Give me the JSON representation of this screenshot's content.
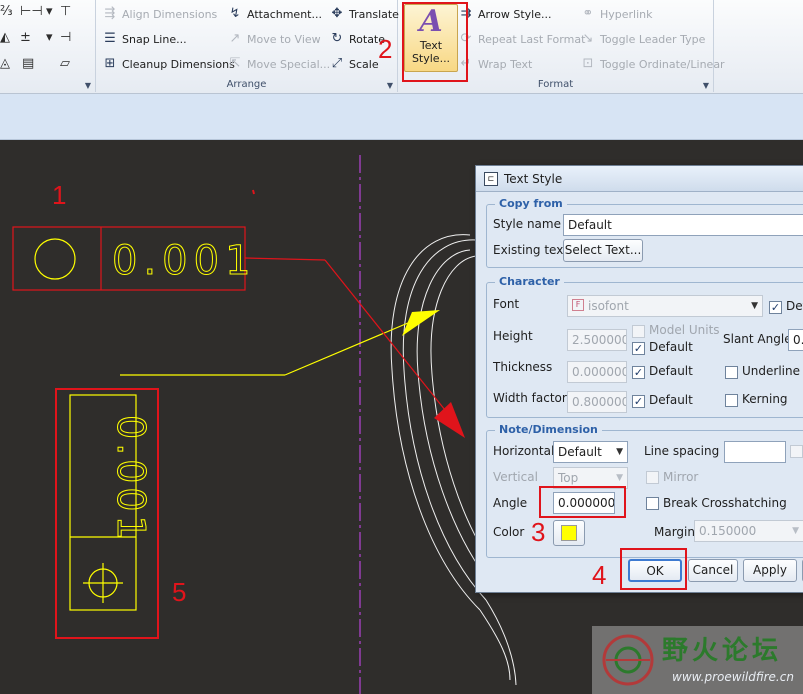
{
  "ribbon": {
    "arrange": {
      "label": "Arrange",
      "align_dimensions": "Align Dimensions",
      "snap_line": "Snap Line...",
      "cleanup_dimensions": "Cleanup Dimensions",
      "attachment": "Attachment...",
      "move_to_view": "Move to View",
      "move_special": "Move Special...",
      "translate": "Translate",
      "rotate": "Rotate",
      "scale": "Scale"
    },
    "format": {
      "label": "Format",
      "text_style": "Text Style...",
      "arrow_style": "Arrow Style...",
      "repeat_last_format": "Repeat Last Format",
      "wrap_text": "Wrap Text",
      "hyperlink": "Hyperlink",
      "toggle_leader_type": "Toggle Leader Type",
      "toggle_ordinate_linear": "Toggle Ordinate/Linear"
    }
  },
  "canvas": {
    "tolerance_value_horizontal": "0.001",
    "tolerance_value_vertical": "0.001"
  },
  "annotations": {
    "n1": "1",
    "n2": "2",
    "n3": "3",
    "n4": "4",
    "n5": "5",
    "color": "#e0141b"
  },
  "dialog": {
    "title": "Text Style",
    "copy_from": {
      "legend": "Copy from",
      "style_name_label": "Style name",
      "style_name_value": "Default",
      "existing_text_label": "Existing text",
      "select_text_button": "Select Text..."
    },
    "character": {
      "legend": "Character",
      "font_label": "Font",
      "font_value": "isofont",
      "font_default_checkbox": "Def",
      "height_label": "Height",
      "height_value": "2.500000",
      "model_units": "Model Units",
      "default_label": "Default",
      "slant_angle_label": "Slant Angle",
      "slant_angle_value": "0.",
      "thickness_label": "Thickness",
      "thickness_value": "0.000000",
      "underline": "Underline",
      "width_factor_label": "Width factor",
      "width_factor_value": "0.800000",
      "kerning": "Kerning"
    },
    "note_dimension": {
      "legend": "Note/Dimension",
      "horizontal_label": "Horizontal",
      "horizontal_value": "Default",
      "line_spacing_label": "Line spacing",
      "vertical_label": "Vertical",
      "vertical_value": "Top",
      "mirror": "Mirror",
      "angle_label": "Angle",
      "angle_value": "0.000000",
      "break_crosshatching": "Break Crosshatching",
      "color_label": "Color",
      "color_value": "#ffff00",
      "margin_label": "Margin",
      "margin_value": "0.150000"
    },
    "buttons": {
      "ok": "OK",
      "cancel": "Cancel",
      "apply": "Apply"
    }
  },
  "watermark": {
    "title": "野火论坛",
    "url": "www.proewildfire.cn"
  },
  "colors": {
    "canvas_bg": "#2f2d2b",
    "yellow": "#ffff00",
    "centerline": "#9b3fb5"
  }
}
